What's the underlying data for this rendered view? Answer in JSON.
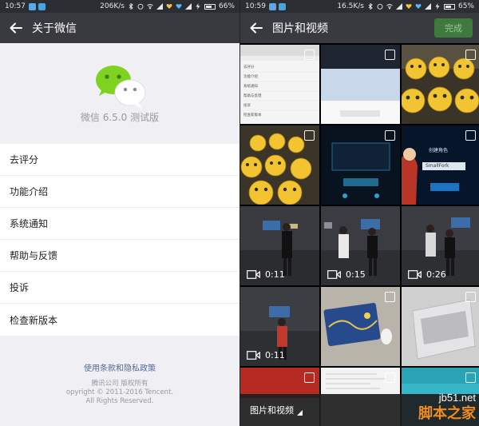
{
  "left": {
    "status": {
      "time": "10:57",
      "speed": "206K/s",
      "battery": "66%"
    },
    "title": "关于微信",
    "version": "微信 6.5.0 测试版",
    "menu": [
      "去评分",
      "功能介绍",
      "系统通知",
      "帮助与反馈",
      "投诉",
      "检查新版本"
    ],
    "footer": {
      "link": "使用条款和隐私政策",
      "company": "腾讯公司 版权所有",
      "copyright": "opyright © 2011-2016 Tencent.",
      "rights": "All Rights Reserved."
    }
  },
  "right": {
    "status": {
      "time": "10:59",
      "speed": "16.5K/s",
      "battery": "65%"
    },
    "title": "图片和视频",
    "done": "完成",
    "videos": [
      "0:11",
      "0:15",
      "0:26",
      "0:11"
    ],
    "bottom_label": "图片和视频",
    "tile1_lines": [
      "去评分",
      "功能介绍",
      "系统通知",
      "帮助与反馈",
      "投诉",
      "检查新版本"
    ],
    "tile6_title": "创建角色",
    "tile6_name": "SmallFork"
  },
  "watermark": {
    "site": "jb51.net",
    "name": "脚本之家"
  },
  "colors": {
    "appbar": "#393a3f",
    "wechat_green": "#7ed321",
    "link": "#576b95",
    "done_bg": "#3d7a3b"
  }
}
